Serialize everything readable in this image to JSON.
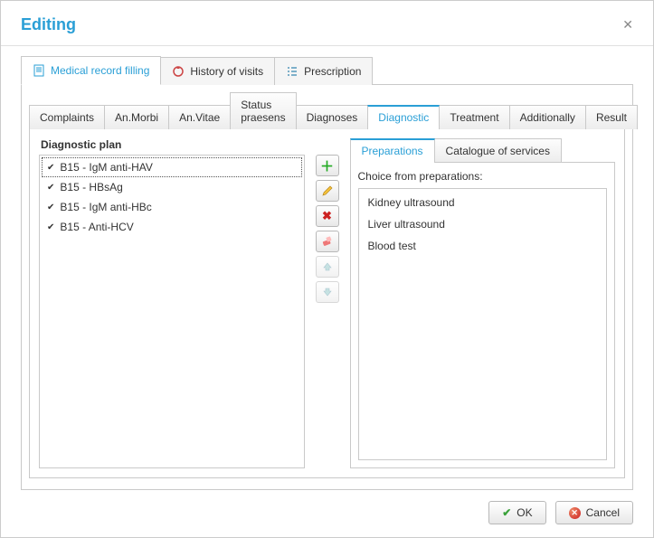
{
  "window": {
    "title": "Editing"
  },
  "top_tabs": {
    "record": "Medical record filling",
    "history": "History of visits",
    "prescription": "Prescription"
  },
  "inner_tabs": {
    "complaints": "Complaints",
    "an_morbi": "An.Morbi",
    "an_vitae": "An.Vitae",
    "status": "Status praesens",
    "diagnoses": "Diagnoses",
    "diagnostic": "Diagnostic",
    "treatment": "Treatment",
    "additionally": "Additionally",
    "result": "Result"
  },
  "diagnostic_plan": {
    "title": "Diagnostic plan",
    "items": [
      "B15 - IgM anti-HAV",
      "B15 - HBsAg",
      "B15 - IgM anti-HBc",
      "B15 - Anti-HCV"
    ]
  },
  "right_panel": {
    "tabs": {
      "preparations": "Preparations",
      "catalogue": "Catalogue of services"
    },
    "choice_label": "Choice from preparations:",
    "items": [
      "Kidney ultrasound",
      "Liver ultrasound",
      "Blood test"
    ]
  },
  "buttons": {
    "ok": "OK",
    "cancel": "Cancel"
  },
  "icons": {
    "add": "add-icon",
    "edit": "edit-icon",
    "delete": "delete-icon",
    "eraser": "eraser-icon",
    "up": "arrow-up-icon",
    "down": "arrow-down-icon"
  }
}
